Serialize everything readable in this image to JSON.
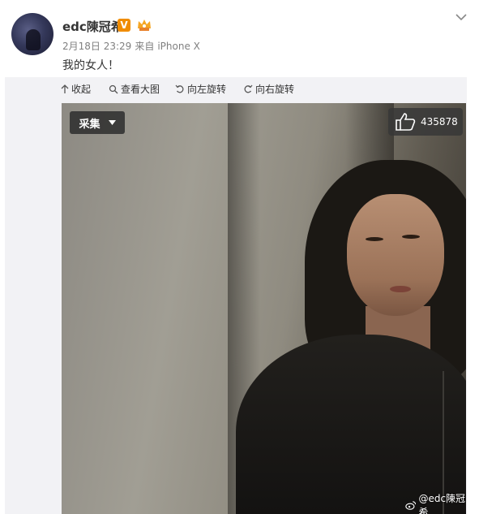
{
  "user": {
    "name": "edc陳冠希",
    "verified_badge": "V"
  },
  "post": {
    "date": "2月18日 23:29",
    "source_prefix": "来自",
    "source": "iPhone X",
    "text": "我的女人！"
  },
  "toolbar": {
    "collapse": "收起",
    "view_large": "查看大图",
    "rotate_left": "向左旋转",
    "rotate_right": "向右旋转"
  },
  "image": {
    "collect_label": "采集",
    "like_count": "435878",
    "watermark": "@edc陳冠希"
  },
  "colors": {
    "badge": "#f08c00",
    "meta_text": "#808080",
    "panel_bg": "#f2f2f5"
  },
  "icons": [
    "avatar",
    "verified-badge-icon",
    "member-crown-icon",
    "chevron-down-icon",
    "collapse-icon",
    "magnifier-icon",
    "rotate-left-icon",
    "rotate-right-icon",
    "dropdown-caret-icon",
    "thumbs-up-icon",
    "weibo-logo-icon"
  ]
}
